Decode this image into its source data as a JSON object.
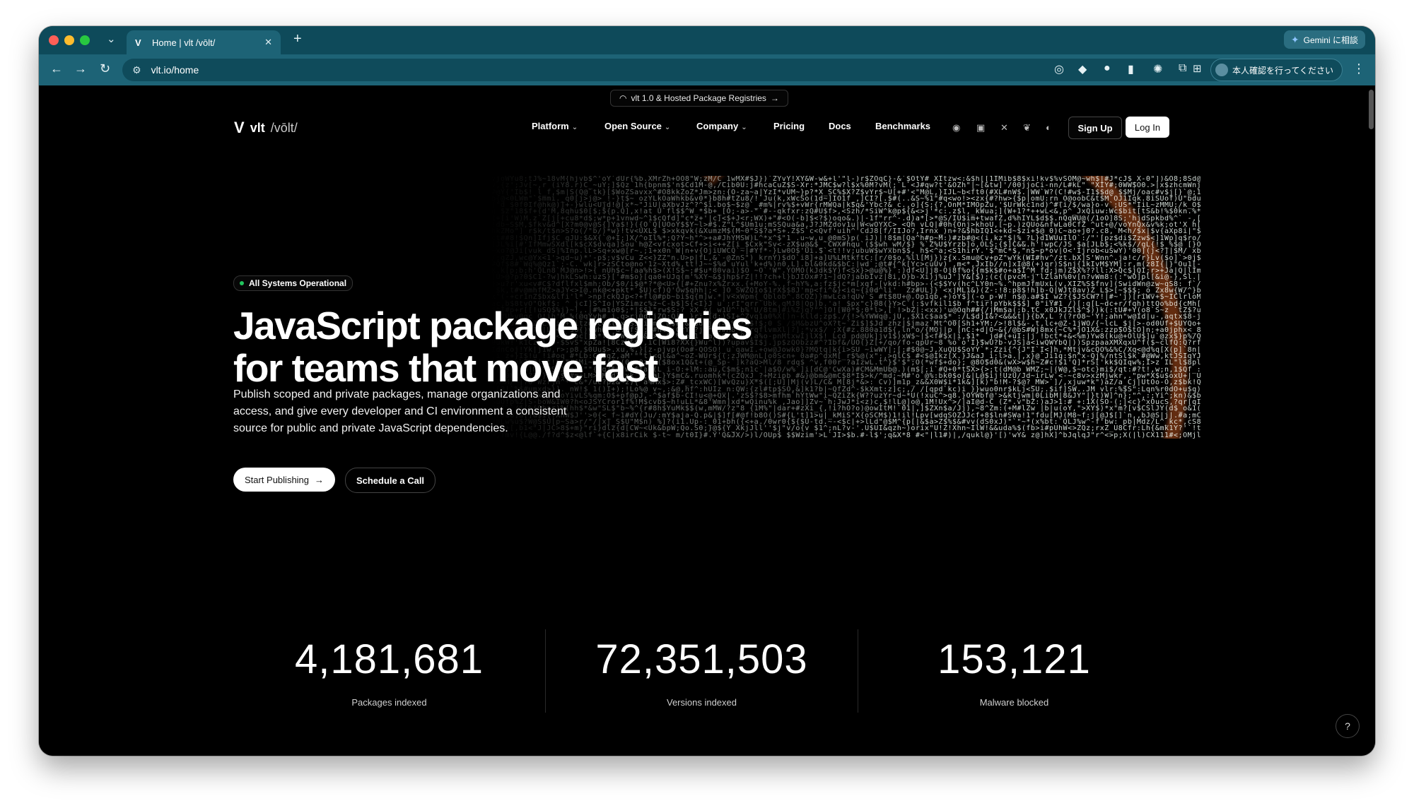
{
  "browser": {
    "tab_title": "Home | vlt /vōlt/",
    "tab_favicon": "V",
    "new_tab_symbol": "+",
    "url": "vlt.io/home",
    "gemini_label": "Gemini に相談",
    "profile_label": "本人確認を行ってください"
  },
  "announcement": "vlt 1.0 & Hosted Package Registries",
  "brand": {
    "logo_glyph": "V",
    "name": "vlt",
    "pronunciation": "/vōlt/"
  },
  "nav": {
    "items": [
      "Platform",
      "Open Source",
      "Company",
      "Pricing",
      "Docs",
      "Benchmarks"
    ],
    "sign_up": "Sign Up",
    "log_in": "Log In",
    "social_icons": [
      "github-icon",
      "linkedin-icon",
      "x-icon",
      "bluesky-icon",
      "discord-icon"
    ]
  },
  "hero": {
    "status": "All Systems Operational",
    "headline_line1": "JavaScript package registries",
    "headline_line2": "for teams that move fast",
    "subtext": "Publish scoped and private packages, manage organizations and access, and give every developer and CI environment a consistent source for public and private JavaScript dependencies.",
    "cta_primary": "Start Publishing",
    "cta_secondary": "Schedule a Call"
  },
  "stats": [
    {
      "value": "4,181,681",
      "label": "Packages indexed"
    },
    {
      "value": "72,351,503",
      "label": "Versions indexed"
    },
    {
      "value": "153,121",
      "label": "Malware blocked"
    }
  ],
  "colors": {
    "tabstrip": "#0e4a5a",
    "toolbar": "#1d6376",
    "page_bg": "#000000",
    "status_dot": "#22c55e"
  }
}
